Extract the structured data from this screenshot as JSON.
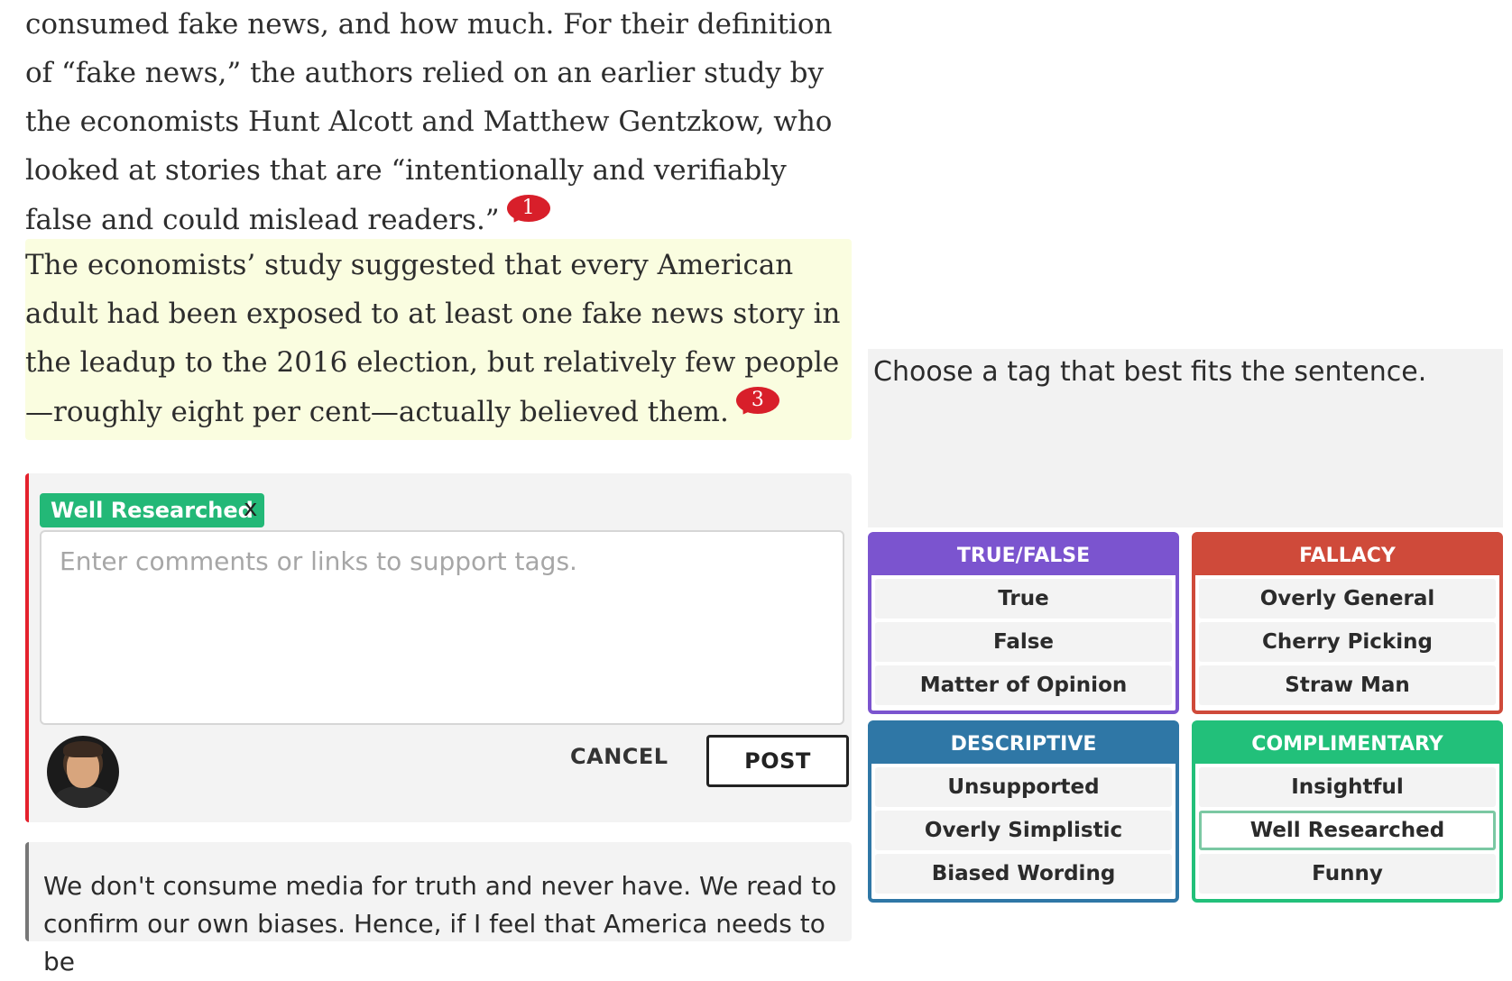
{
  "article": {
    "paragraph1": "consumed fake news, and how much. For their definition of “fake news,” the authors relied on an earlier study by the economists Hunt Alcott and Matthew Gentzkow, who looked at stories that are “intentionally and verifiably false and could mislead readers.”",
    "paragraph1_badge": "1",
    "paragraph2": "The economists’ study suggested that every American adult had been exposed to at least one fake news story in the leadup to the 2016 election, but relatively few people—roughly eight per cent—actually believed them.",
    "paragraph2_badge": "3"
  },
  "comment_form": {
    "selected_tag": "Well Researched",
    "remove_tag_label": "x",
    "placeholder": "Enter comments or links to support tags.",
    "value": "",
    "cancel_label": "CANCEL",
    "post_label": "POST"
  },
  "next_comment": {
    "text": "We don't consume media for truth and never have. We read to confirm our own biases. Hence, if I feel that America needs to be"
  },
  "tag_picker": {
    "prompt": "Choose a tag that best fits the sentence.",
    "categories": [
      {
        "title": "TRUE/FALSE",
        "color": "#7b54cf",
        "items": [
          "True",
          "False",
          "Matter of Opinion"
        ]
      },
      {
        "title": "FALLACY",
        "color": "#cf4a3a",
        "items": [
          "Overly General",
          "Cherry Picking",
          "Straw Man"
        ]
      },
      {
        "title": "DESCRIPTIVE",
        "color": "#2f77a6",
        "items": [
          "Unsupported",
          "Overly Simplistic",
          "Biased Wording"
        ]
      },
      {
        "title": "COMPLIMENTARY",
        "color": "#22c07a",
        "items": [
          "Insightful",
          "Well Researched",
          "Funny"
        ]
      }
    ],
    "selected": "Well Researched"
  }
}
